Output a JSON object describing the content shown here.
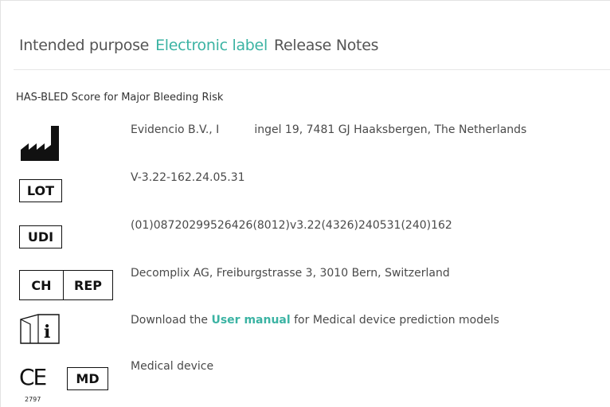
{
  "tabs": [
    {
      "label": "Intended purpose",
      "active": false
    },
    {
      "label": "Electronic label",
      "active": true
    },
    {
      "label": "Release Notes",
      "active": false
    }
  ],
  "device_title": "HAS-BLED Score for Major Bleeding Risk",
  "rows": {
    "manufacturer": {
      "icon": "factory-icon",
      "text_start": "Evidencio B.V., I",
      "text_end": "ingel 19, 7481 GJ Haaksbergen, The Netherlands"
    },
    "lot": {
      "symbol": "LOT",
      "text": "V-3.22-162.24.05.31"
    },
    "udi": {
      "symbol": "UDI",
      "text": "(01)08720299526426(8012)v3.22(4326)240531(240)162"
    },
    "rep": {
      "symbol_left": "CH",
      "symbol_right": "REP",
      "text": "Decomplix AG, Freiburgstrasse 3, 3010 Bern, Switzerland"
    },
    "manual": {
      "icon": "instructions-info-icon",
      "text_before": "Download the",
      "link": "User manual",
      "text_after": "for Medical device prediction models"
    },
    "medical": {
      "ce_mark": "CE",
      "ce_number": "2797",
      "symbol": "MD",
      "text": "Medical device"
    }
  },
  "colors": {
    "accent": "#3bb3a3",
    "text": "#4a4a4a",
    "rule": "#e6e6e6"
  }
}
